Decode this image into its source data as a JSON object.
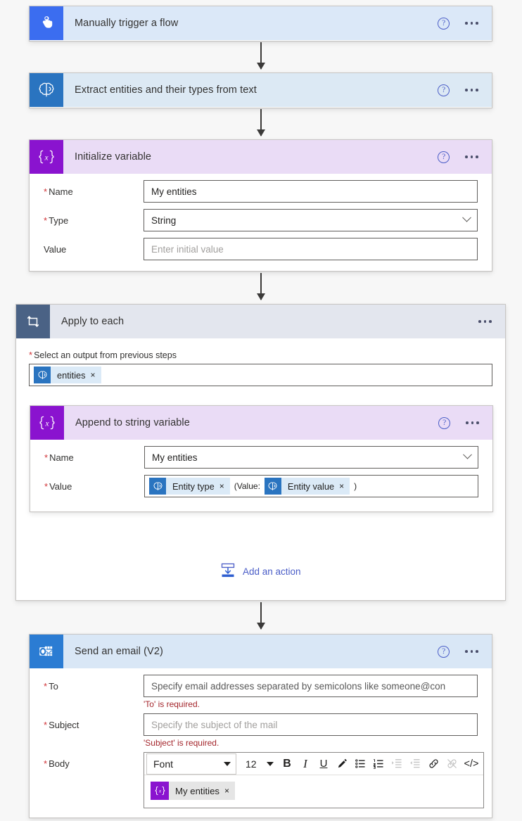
{
  "meta": {
    "app": "Power Automate flow designer"
  },
  "colors": {
    "trigger_icon": "#3b6df0",
    "ai_icon": "#2a74c0",
    "variable_icon": "#8a13cf",
    "loop_icon": "#4a6285",
    "outlook_icon": "#2b7cd3",
    "trigger_header": "#dbe8f8",
    "ai_header": "#dce9f4",
    "variable_header": "#eadcf6",
    "loop_header": "#e3e6ee",
    "mail_header": "#d9e7f6",
    "required_red": "#d13438",
    "error_red": "#a4262c",
    "link_blue": "#4a5dc7",
    "token_blue": "#dbeaf7",
    "token_gray": "#e5e5e5"
  },
  "steps": {
    "trigger": {
      "title": "Manually trigger a flow",
      "icon": "tap-hand-icon",
      "help": "?",
      "more": "..."
    },
    "extract": {
      "title": "Extract entities and their types from text",
      "icon": "ai-brain-icon",
      "help": "?",
      "more": "..."
    },
    "init_variable": {
      "title": "Initialize variable",
      "icon": "variable-braces-icon",
      "help": "?",
      "more": "...",
      "fields": {
        "name_label": "Name",
        "name_value": "My entities",
        "type_label": "Type",
        "type_value": "String",
        "value_label": "Value",
        "value_placeholder": "Enter initial value"
      }
    },
    "apply_to_each": {
      "title": "Apply to each",
      "icon": "loop-icon",
      "more": "...",
      "select_label": "Select an output from previous steps",
      "select_token": {
        "label": "entities",
        "icon": "ai-brain-icon",
        "remove": "×"
      },
      "add_action": {
        "label": "Add an action",
        "icon": "insert-action-icon"
      }
    },
    "append": {
      "title": "Append to string variable",
      "icon": "variable-braces-icon",
      "help": "?",
      "more": "...",
      "fields": {
        "name_label": "Name",
        "name_value": "My entities",
        "value_label": "Value",
        "value_tokens": [
          {
            "kind": "token",
            "label": "Entity type",
            "icon": "ai-brain-icon",
            "remove": "×"
          },
          {
            "kind": "text",
            "label": "(Value:"
          },
          {
            "kind": "token",
            "label": "Entity value",
            "icon": "ai-brain-icon",
            "remove": "×"
          },
          {
            "kind": "text",
            "label": ")"
          }
        ]
      }
    },
    "send_email": {
      "title": "Send an email (V2)",
      "icon": "outlook-icon",
      "help": "?",
      "more": "...",
      "fields": {
        "to_label": "To",
        "to_placeholder": "Specify email addresses separated by semicolons like someone@con",
        "to_error": "'To' is required.",
        "subject_label": "Subject",
        "subject_placeholder": "Specify the subject of the mail",
        "subject_error": "'Subject' is required.",
        "body_label": "Body"
      },
      "editor": {
        "font_name": "Font",
        "font_size": "12",
        "tools": [
          {
            "name": "bold-icon",
            "glyph": "B",
            "disabled": false
          },
          {
            "name": "italic-icon",
            "glyph": "I",
            "disabled": false
          },
          {
            "name": "underline-icon",
            "glyph": "U",
            "disabled": false
          },
          {
            "name": "text-highlight-pen-icon",
            "glyph": "✎",
            "disabled": false
          },
          {
            "name": "bulleted-list-icon",
            "glyph": "☰",
            "disabled": false
          },
          {
            "name": "numbered-list-icon",
            "glyph": "☰",
            "disabled": false
          },
          {
            "name": "increase-indent-icon",
            "glyph": "☰",
            "disabled": true
          },
          {
            "name": "decrease-indent-icon",
            "glyph": "☰",
            "disabled": true
          },
          {
            "name": "insert-link-icon",
            "glyph": "ὑ7",
            "disabled": false
          },
          {
            "name": "remove-link-icon",
            "glyph": "ὑ7",
            "disabled": true
          },
          {
            "name": "code-view-icon",
            "glyph": "</>",
            "disabled": false
          }
        ],
        "body_token": {
          "label": "My entities",
          "icon": "variable-braces-icon",
          "remove": "×"
        }
      }
    }
  }
}
